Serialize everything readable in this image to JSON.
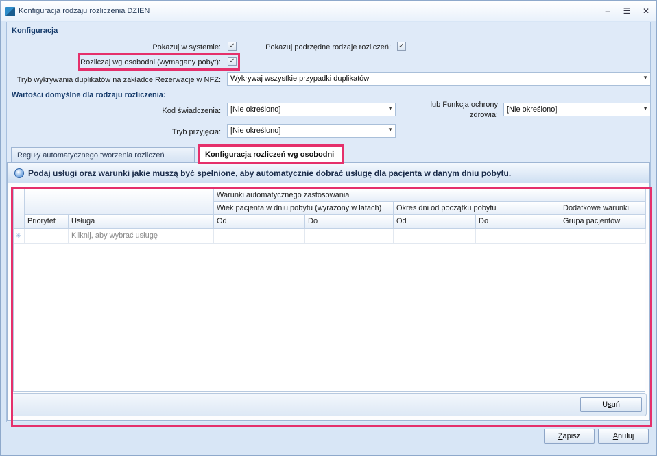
{
  "window": {
    "title": "Konfiguracja rodzaju rozliczenia DZIEN",
    "controls": {
      "minimize": "–",
      "restore": "☰",
      "close": "✕"
    }
  },
  "konfiguracja": {
    "section_title": "Konfiguracja",
    "pokazuj_w_systemie": {
      "label": "Pokazuj w systemie:",
      "checked": true
    },
    "pokazuj_podrzedne": {
      "label": "Pokazuj podrzędne rodzaje rozliczeń:",
      "checked": true
    },
    "rozliczaj_wg_osobodni": {
      "label": "Rozliczaj wg osobodni (wymagany pobyt):",
      "checked": true
    },
    "tryb_duplikatow": {
      "label": "Tryb wykrywania duplikatów na zakładce Rezerwacje w NFZ:",
      "value": "Wykrywaj wszystkie przypadki duplikatów"
    }
  },
  "wartosci_domyslne": {
    "section_title": "Wartości domyślne dla rodzaju rozliczenia:",
    "kod_swiadczenia": {
      "label": "Kod świadczenia:",
      "value": "[Nie określono]"
    },
    "funkcja_ochrony": {
      "label_line1": "lub Funkcja ochrony",
      "label_line2": "zdrowia:",
      "value": "[Nie określono]"
    },
    "tryb_przyjecia": {
      "label": "Tryb przyjęcia:",
      "value": "[Nie określono]"
    }
  },
  "tabs": [
    {
      "label": "Reguły automatycznego tworzenia rozliczeń",
      "active": false
    },
    {
      "label": "Konfiguracja rozliczeń wg osobodni",
      "active": true
    }
  ],
  "info_bar": {
    "text": "Podaj usługi oraz warunki jakie muszą być spełnione, aby automatycznie dobrać usługę dla pacjenta w danym dniu pobytu."
  },
  "grid": {
    "band_top": "Warunki automatycznego zastosowania",
    "band_mid": {
      "wiek": "Wiek pacjenta w dniu pobytu (wyrażony w latach)",
      "okres": "Okres dni od początku pobytu",
      "dodatkowe": "Dodatkowe warunki"
    },
    "columns": {
      "priorytet": "Priorytet",
      "usluga": "Usługa",
      "wiek_od": "Od",
      "wiek_do": "Do",
      "okres_od": "Od",
      "okres_do": "Do",
      "grupa": "Grupa pacjentów"
    },
    "new_row": {
      "indicator": "✳",
      "placeholder": "Kliknij, aby wybrać usługę"
    },
    "delete_button": {
      "pre": "U",
      "key": "s",
      "post": "uń"
    }
  },
  "footer": {
    "save": {
      "key": "Z",
      "rest": "apisz"
    },
    "cancel": {
      "key": "A",
      "rest": "nuluj"
    }
  },
  "colors": {
    "highlight": "#e5306b",
    "section_title": "#153a6a",
    "window_bg": "#d8e6f6"
  }
}
